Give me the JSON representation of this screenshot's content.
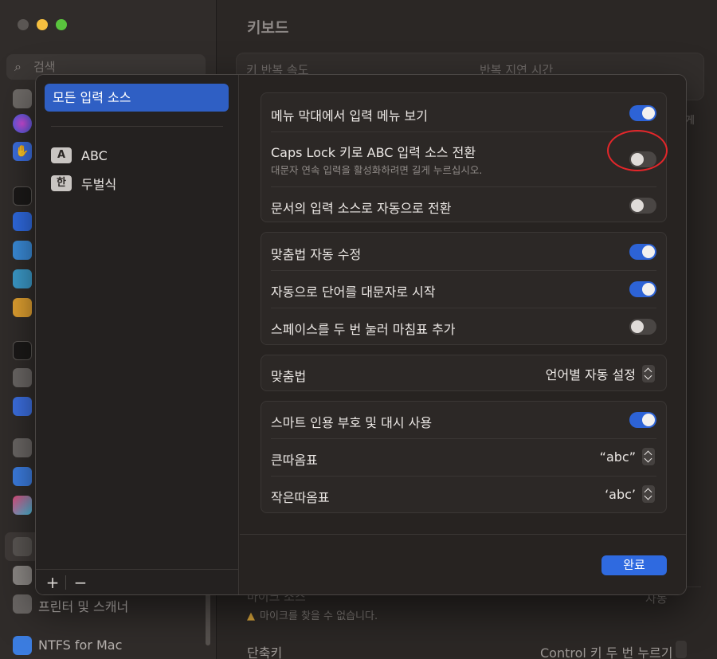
{
  "background": {
    "search_placeholder": "검색",
    "window_title": "키보드",
    "header_col1": "키 반복 속도",
    "header_col2": "반복 지연 시간",
    "sidebar_printer": "프린터 및 스캐너",
    "sidebar_ntfs": "NTFS for Mac",
    "mic_label": "마이크 소스",
    "mic_value": "자동",
    "mic_warning": "마이크를 찾을 수 없습니다.",
    "shortcut_label": "단축키",
    "shortcut_value": "Control 키 두 번 누르기",
    "edge_fragment": "게"
  },
  "dialog": {
    "sidebar": {
      "selected_item": "모든 입력 소스",
      "sources": [
        {
          "badge": "A",
          "label": "ABC"
        },
        {
          "badge": "한",
          "label": "두벌식"
        }
      ],
      "add_label": "+",
      "remove_label": "−"
    },
    "group1": {
      "show_input_menu": {
        "label": "메뉴 막대에서 입력 메뉴 보기",
        "on": true
      },
      "caps_lock_switch": {
        "label": "Caps Lock 키로 ABC 입력 소스 전환",
        "sublabel": "대문자 연속 입력을 활성화하려면 길게 누르십시오.",
        "on": false
      },
      "auto_switch_doc": {
        "label": "문서의 입력 소스로 자동으로 전환",
        "on": false
      }
    },
    "group2": {
      "auto_correct": {
        "label": "맞춤법 자동 수정",
        "on": true
      },
      "auto_capitalize": {
        "label": "자동으로 단어를 대문자로 시작",
        "on": true
      },
      "double_space_period": {
        "label": "스페이스를 두 번 눌러 마침표 추가",
        "on": false
      }
    },
    "group3": {
      "spelling_label": "맞춤법",
      "spelling_value": "언어별 자동 설정"
    },
    "group4": {
      "smart_quotes": {
        "label": "스마트 인용 부호 및 대시 사용",
        "on": true
      },
      "double_quotes_label": "큰따옴표",
      "double_quotes_value": "“abc”",
      "single_quotes_label": "작은따옴표",
      "single_quotes_value": "‘abc’"
    },
    "done_label": "완료"
  },
  "colors": {
    "accent": "#2d63d6",
    "selection": "#2f5fc4",
    "highlight_oval": "#e4262a"
  }
}
